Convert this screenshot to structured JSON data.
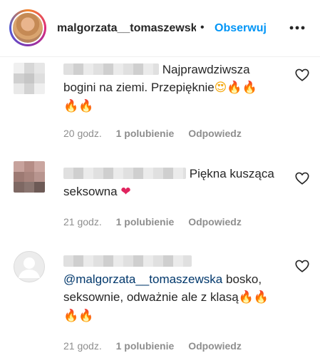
{
  "header": {
    "username": "malgorzata__tomaszewska",
    "separator": "•",
    "follow_label": "Obserwuj"
  },
  "comments": [
    {
      "text": "Najprawdziwsza bogini na ziemi. Przepięknie",
      "emojis": [
        "😍",
        "🔥",
        "🔥",
        "🔥",
        "🔥"
      ],
      "time": "20 godz.",
      "likes": "1 polubienie",
      "reply": "Odpowiedz"
    },
    {
      "text": "Piękna kusząca seksowna",
      "emojis": [
        "❤"
      ],
      "time": "21 godz.",
      "likes": "1 polubienie",
      "reply": "Odpowiedz"
    },
    {
      "mention": "@malgorzata__tomaszewska",
      "text": "bosko, seksownie, odważnie ale z klasą",
      "emojis": [
        "🔥",
        "🔥",
        "🔥",
        "🔥"
      ],
      "time": "21 godz.",
      "likes": "1 polubienie",
      "reply": "Odpowiedz"
    }
  ],
  "icons": {
    "more": "more-horizontal-icon",
    "like": "heart-outline-icon",
    "default_avatar": "default-avatar-icon"
  },
  "colors": {
    "link": "#0095f6",
    "mention": "#00376b",
    "muted": "#8e8e8e"
  }
}
